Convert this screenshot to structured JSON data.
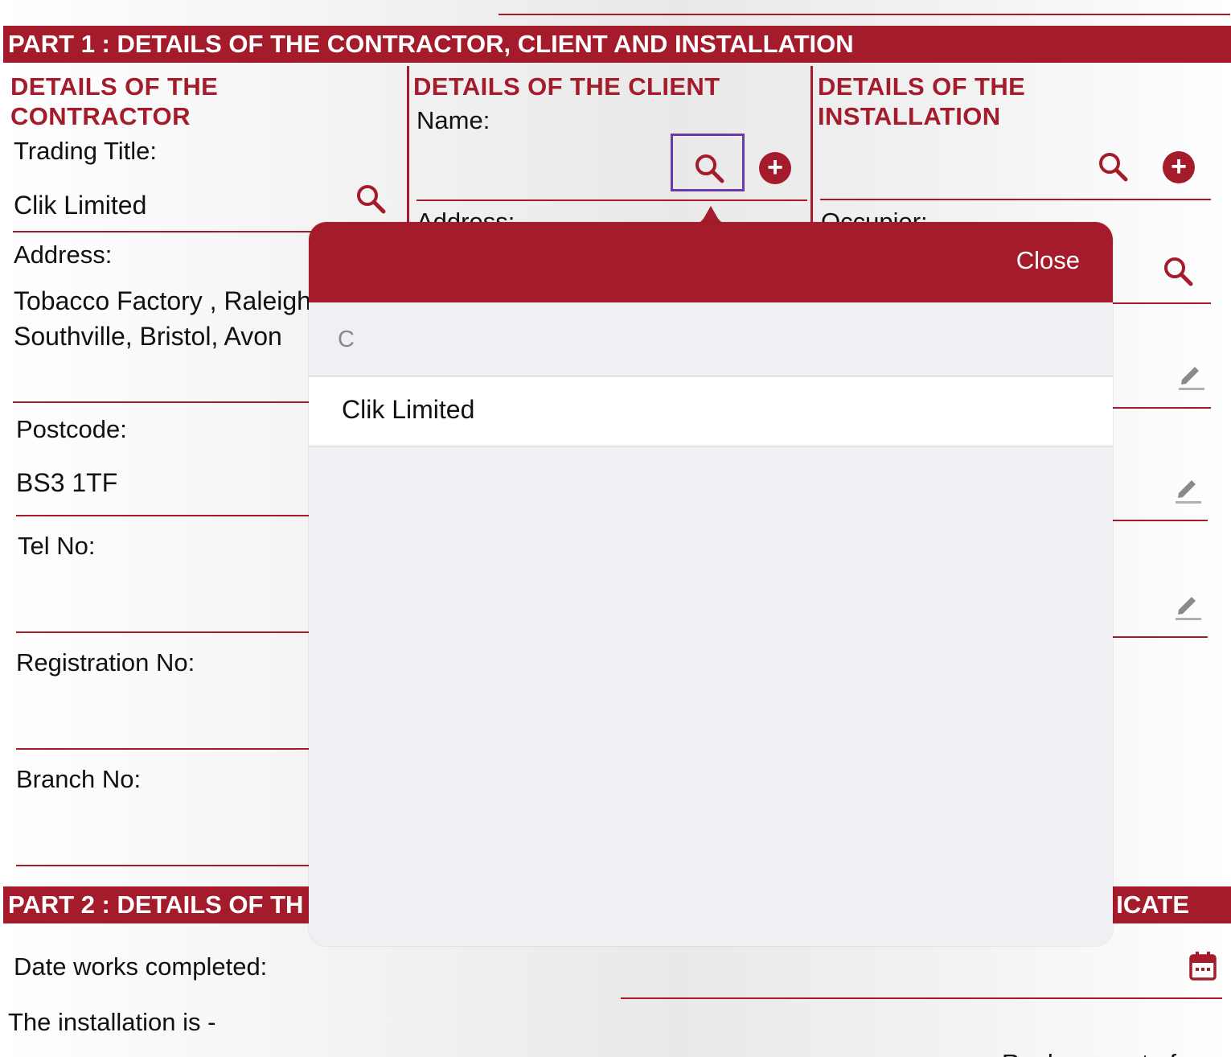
{
  "part1": {
    "title": "PART 1 : DETAILS OF THE CONTRACTOR, CLIENT AND INSTALLATION",
    "contractor": {
      "heading": "DETAILS OF THE CONTRACTOR",
      "trading_title_label": "Trading Title:",
      "trading_title_value": "Clik Limited",
      "address_label": "Address:",
      "address_value": "Tobacco Factory , Raleigh Road, Southville, Bristol, Avon",
      "postcode_label": "Postcode:",
      "postcode_value": "BS3 1TF",
      "tel_label": "Tel No:",
      "registration_label": "Registration No:",
      "branch_label": "Branch No:"
    },
    "client": {
      "heading": "DETAILS OF THE CLIENT",
      "name_label": "Name:",
      "address_label": "Address:"
    },
    "installation": {
      "heading": "DETAILS OF THE INSTALLATION",
      "occupier_label": "Occupier:"
    }
  },
  "part2": {
    "title_left": "PART 2 : DETAILS OF TH",
    "title_right": "ICATE",
    "date_completed_label": "Date works completed:",
    "installation_is_label": "The installation is -",
    "bottom_partial": "Replacement of"
  },
  "popover": {
    "close_label": "Close",
    "search_value": "C",
    "results": [
      "Clik Limited"
    ]
  },
  "colors": {
    "accent": "#a41b2b",
    "focus": "#6a3aa6",
    "popover_bg": "#efeff4"
  },
  "icons": [
    "search-icon",
    "add-icon",
    "edit-icon",
    "calendar-icon"
  ]
}
